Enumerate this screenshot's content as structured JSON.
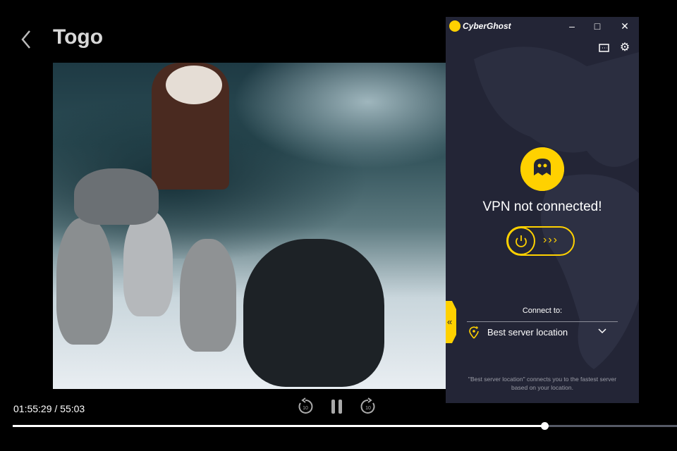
{
  "player": {
    "title": "Togo",
    "time": "01:55:29 / 55:03",
    "progress": 0.8,
    "controls": {
      "rewind": "10",
      "forward": "10"
    }
  },
  "vpn": {
    "app_name": "CyberGhost",
    "status": "VPN not connected!",
    "connect_label": "Connect to:",
    "server": "Best server location",
    "note": "\"Best server location\" connects you to the fastest server based on your location.",
    "colors": {
      "accent": "#ffd100",
      "background": "#232536"
    }
  }
}
